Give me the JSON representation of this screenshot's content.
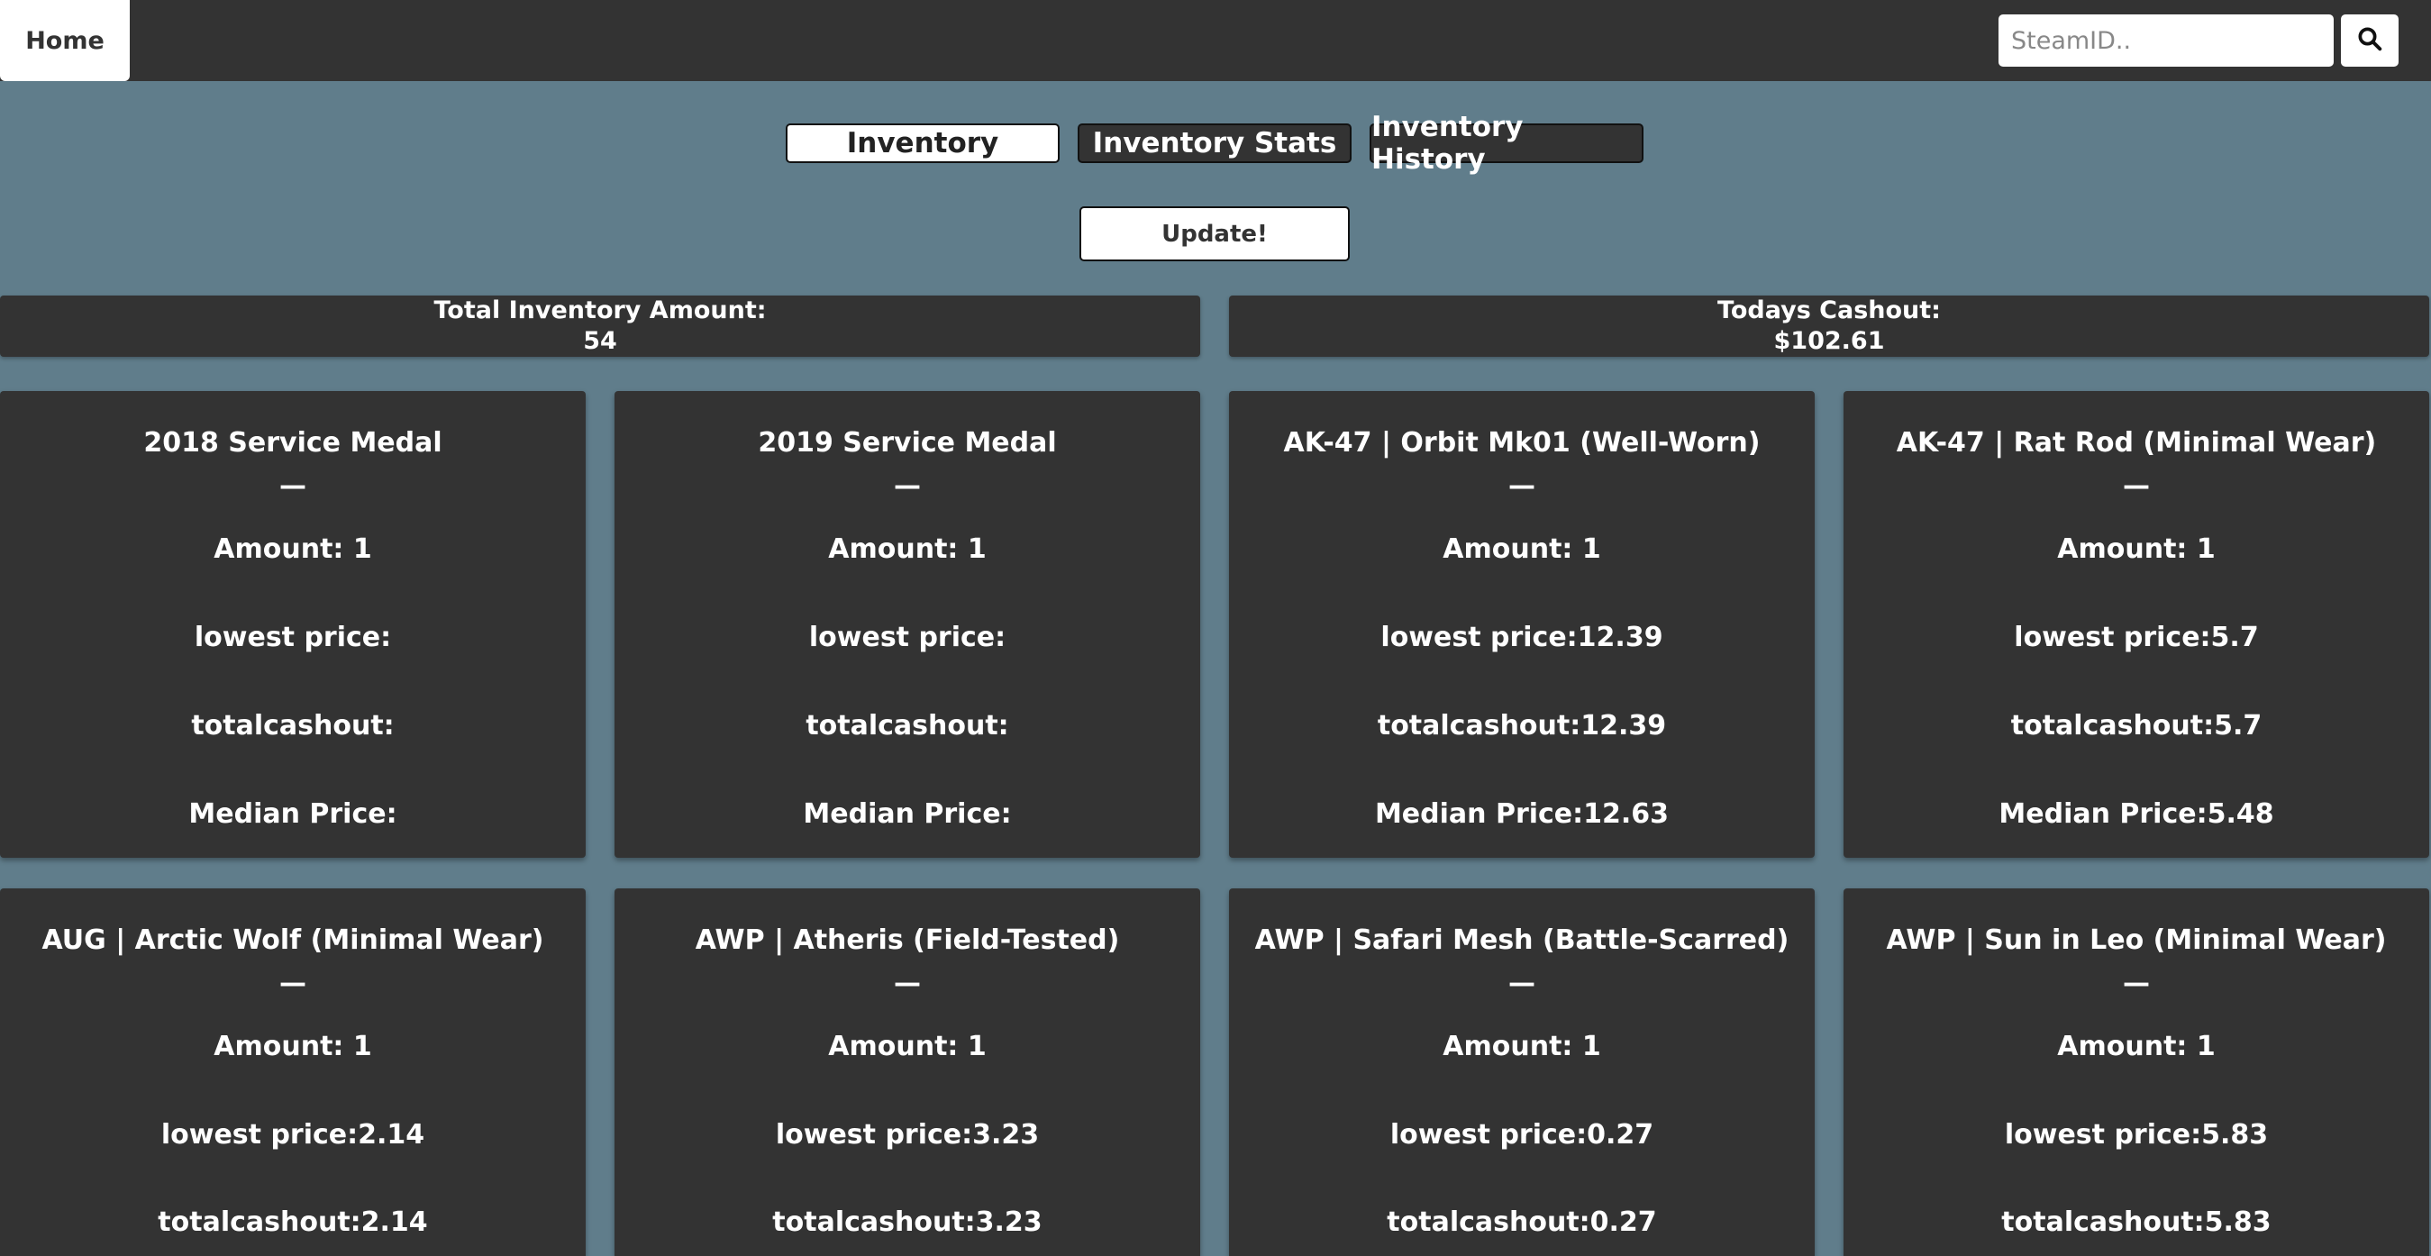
{
  "nav": {
    "home_label": "Home",
    "search_placeholder": "SteamID..",
    "search_icon": "magnifier-icon"
  },
  "tabs": [
    {
      "label": "Inventory",
      "active": true
    },
    {
      "label": "Inventory Stats",
      "active": false
    },
    {
      "label": "Inventory History",
      "active": false
    }
  ],
  "update_label": "Update!",
  "summary": {
    "total_label": "Total Inventory Amount:",
    "total_value": "54",
    "cashout_label": "Todays Cashout:",
    "cashout_value": "$102.61"
  },
  "items": [
    {
      "name": "2018 Service Medal",
      "divider": "—",
      "amount": "Amount: 1",
      "lowest": "lowest price:",
      "cashout": "totalcashout:",
      "median": "Median Price:"
    },
    {
      "name": "2019 Service Medal",
      "divider": "—",
      "amount": "Amount: 1",
      "lowest": "lowest price:",
      "cashout": "totalcashout:",
      "median": "Median Price:"
    },
    {
      "name": "AK-47 | Orbit Mk01 (Well-Worn)",
      "divider": "—",
      "amount": "Amount: 1",
      "lowest": "lowest price:12.39",
      "cashout": "totalcashout:12.39",
      "median": "Median Price:12.63"
    },
    {
      "name": "AK-47 | Rat Rod (Minimal Wear)",
      "divider": "—",
      "amount": "Amount: 1",
      "lowest": "lowest price:5.7",
      "cashout": "totalcashout:5.7",
      "median": "Median Price:5.48"
    },
    {
      "name": "AUG | Arctic Wolf (Minimal Wear)",
      "divider": "—",
      "amount": "Amount: 1",
      "lowest": "lowest price:2.14",
      "cashout": "totalcashout:2.14"
    },
    {
      "name": "AWP | Atheris (Field-Tested)",
      "divider": "—",
      "amount": "Amount: 1",
      "lowest": "lowest price:3.23",
      "cashout": "totalcashout:3.23"
    },
    {
      "name": "AWP | Safari Mesh (Battle-Scarred)",
      "divider": "—",
      "amount": "Amount: 1",
      "lowest": "lowest price:0.27",
      "cashout": "totalcashout:0.27"
    },
    {
      "name": "AWP | Sun in Leo (Minimal Wear)",
      "divider": "—",
      "amount": "Amount: 1",
      "lowest": "lowest price:5.83",
      "cashout": "totalcashout:5.83"
    }
  ]
}
